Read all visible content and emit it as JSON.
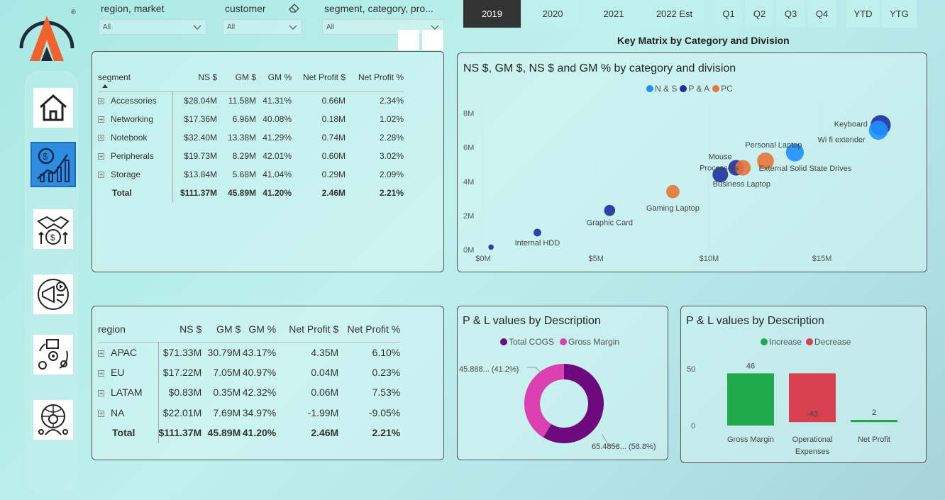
{
  "colors": {
    "ns": "#1e90ff",
    "pa": "#1f2e9e",
    "pc": "#e8763a",
    "total_cogs": "#6e0a7e",
    "gross_margin_donut": "#dc3fb0",
    "increase": "#1fa94a",
    "decrease": "#d6404f",
    "logo_orange": "#f0612d",
    "logo_dark": "#1f2b3a"
  },
  "nav": {
    "items": [
      {
        "name": "home",
        "icon": "home-icon"
      },
      {
        "name": "finance",
        "icon": "finance-growth-icon"
      },
      {
        "name": "deals",
        "icon": "handshake-money-icon"
      },
      {
        "name": "marketing",
        "icon": "megaphone-icon"
      },
      {
        "name": "supply-chain",
        "icon": "supply-chain-icon"
      },
      {
        "name": "support",
        "icon": "global-support-icon"
      }
    ]
  },
  "slicers": [
    {
      "label": "region, market",
      "value": "All"
    },
    {
      "label": "customer",
      "value": "All"
    },
    {
      "label": "segment, category, pro...",
      "value": "All"
    }
  ],
  "year_tabs": [
    "2019",
    "2020",
    "2021",
    "2022 Est"
  ],
  "quarter_tabs": [
    "Q1",
    "Q2",
    "Q3",
    "Q4"
  ],
  "period_tabs": [
    "YTD",
    "YTG"
  ],
  "key_matrix_title": "Key Matrix by Category and Division",
  "segment_table": {
    "headers": [
      "segment",
      "NS $",
      "GM $",
      "GM %",
      "Net Profit $",
      "Net Profit %"
    ],
    "rows": [
      [
        "Accessories",
        "$28.04M",
        "11.58M",
        "41.31%",
        "0.66M",
        "2.34%"
      ],
      [
        "Networking",
        "$17.36M",
        "6.96M",
        "40.08%",
        "0.18M",
        "1.02%"
      ],
      [
        "Notebook",
        "$32.40M",
        "13.38M",
        "41.29%",
        "0.74M",
        "2.28%"
      ],
      [
        "Peripherals",
        "$19.73M",
        "8.29M",
        "42.01%",
        "0.60M",
        "3.02%"
      ],
      [
        "Storage",
        "$13.84M",
        "5.68M",
        "41.04%",
        "0.29M",
        "2.09%"
      ]
    ],
    "total": [
      "Total",
      "$111.37M",
      "45.89M",
      "41.20%",
      "2.46M",
      "2.21%"
    ]
  },
  "region_table": {
    "headers": [
      "region",
      "NS $",
      "GM $",
      "GM %",
      "Net Profit $",
      "Net Profit %"
    ],
    "rows": [
      [
        "APAC",
        "$71.33M",
        "30.79M",
        "43.17%",
        "4.35M",
        "6.10%"
      ],
      [
        "EU",
        "$17.22M",
        "7.05M",
        "40.97%",
        "0.04M",
        "0.23%"
      ],
      [
        "LATAM",
        "$0.83M",
        "0.35M",
        "42.32%",
        "0.06M",
        "7.53%"
      ],
      [
        "NA",
        "$22.01M",
        "7.69M",
        "34.97%",
        "-1.99M",
        "-9.05%"
      ]
    ],
    "total": [
      "Total",
      "$111.37M",
      "45.89M",
      "41.20%",
      "2.46M",
      "2.21%"
    ]
  },
  "chart_data": [
    {
      "type": "scatter",
      "title": "NS $, GM $, NS $ and GM % by category and division",
      "legend": [
        "N & S",
        "P & A",
        "PC"
      ],
      "legend_position": "top-center",
      "xlim": [
        0,
        18500000
      ],
      "ylim": [
        0,
        8400000
      ],
      "xticks": [
        "$0M",
        "$5M",
        "$10M",
        "$15M"
      ],
      "yticks": [
        "0M",
        "2M",
        "4M",
        "6M",
        "8M"
      ],
      "points": [
        {
          "label": "Internal HDD",
          "division": "P & A",
          "x": 2400000,
          "y": 1000000,
          "size": 0.15
        },
        {
          "label": "",
          "division": "P & A",
          "x": 350000,
          "y": 150000,
          "size": 0.05
        },
        {
          "label": "Graphic Card",
          "division": "P & A",
          "x": 5600000,
          "y": 2300000,
          "size": 0.3
        },
        {
          "label": "Gaming Laptop",
          "division": "PC",
          "x": 8400000,
          "y": 3400000,
          "size": 0.4
        },
        {
          "label": "Business Laptop",
          "division": "P & A",
          "x": 10500000,
          "y": 4400000,
          "size": 0.5
        },
        {
          "label": "Processors",
          "division": "P & A",
          "x": 11200000,
          "y": 4800000,
          "size": 0.5
        },
        {
          "label": "Mouse",
          "division": "PC",
          "x": 11500000,
          "y": 4800000,
          "size": 0.5
        },
        {
          "label": "External Solid State Drives",
          "division": "PC",
          "x": 12500000,
          "y": 5200000,
          "size": 0.55
        },
        {
          "label": "Personal Laptop",
          "division": "N & S",
          "x": 13800000,
          "y": 5700000,
          "size": 0.6
        },
        {
          "label": "Keyboard",
          "division": "P & A",
          "x": 17600000,
          "y": 7300000,
          "size": 0.7
        },
        {
          "label": "Wi fi extender",
          "division": "N & S",
          "x": 17500000,
          "y": 7000000,
          "size": 0.65
        }
      ]
    },
    {
      "type": "pie",
      "title": "P & L values by Description",
      "legend": [
        "Total COGS",
        "Gross Margin"
      ],
      "slices": [
        {
          "name": "Total COGS",
          "value": 65.4858,
          "label": "65.4858... (58.8%)"
        },
        {
          "name": "Gross Margin",
          "value": 45.888,
          "label": "45.888... (41.2%)"
        }
      ]
    },
    {
      "type": "bar",
      "title": "P & L values by Description",
      "legend": [
        "Increase",
        "Decrease"
      ],
      "categories": [
        "Gross Margin",
        "Operational Expenses",
        "Net Profit"
      ],
      "values": [
        46,
        -43,
        2
      ],
      "value_labels": [
        "46",
        "-43",
        "2"
      ],
      "yticks": [
        "50",
        "0"
      ],
      "ylim": [
        0,
        55
      ]
    }
  ]
}
